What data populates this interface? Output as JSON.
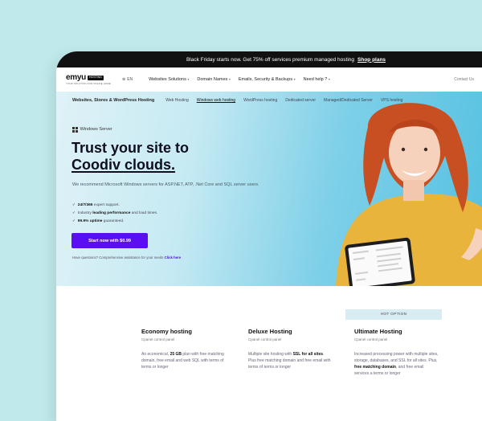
{
  "promo": {
    "text": "Black Friday starts now. Get 75% off services premium managed hosting",
    "link": "Shop plans"
  },
  "nav": {
    "logo_word": "emyu",
    "logo_badge": "HOSTING",
    "logo_tag": "YOUR SOLUTION FOR ONLINE HOME",
    "lang": "EN",
    "items": [
      "Websites Solutions",
      "Domain Names",
      "Emails, Security & Backups",
      "Need help ?"
    ],
    "contact": "Contact Us",
    "button": "S"
  },
  "subnav": {
    "category": "Websites, Stores & WordPress Hosting",
    "items": [
      "Web Hosting",
      "Windows web hosting",
      "WordPress hosting",
      "Dedicated server",
      "Managed/Dedicated Server",
      "VPS hosting"
    ],
    "active_index": 1
  },
  "hero": {
    "badge": "Windows Server",
    "title_line1": "Trust your site to",
    "title_line2": "Coodiv clouds.",
    "lead": "We recommend Microsoft Windows servers for ASP.NET, ATP, .Net Core and SQL server users.",
    "bullets": [
      {
        "bold": "24/7/365",
        "text": " expert support."
      },
      {
        "pre": "Industry ",
        "bold": "leading performance",
        "text": " and load times."
      },
      {
        "bold": "99.9% uptime",
        "text": " guaranteed."
      }
    ],
    "cta": "Start now with $0.99",
    "fineprint": "Have questions? Comprehensive assistance for your needs",
    "fineprint_link": "Click here"
  },
  "plans": {
    "hot_label": "HOT OPTION",
    "items": [
      {
        "name": "Economy hosting",
        "caption": "Cpanel control panel",
        "desc_pre": "An economical, ",
        "desc_bold": "25 GB",
        "desc_post": " plan with free matching domain, free email and web SQL with terms of terms or longer"
      },
      {
        "name": "Deluxe Hosting",
        "caption": "Cpanel control panel",
        "desc_pre": "Multiple site hosting with ",
        "desc_bold": "SSL for all sites",
        "desc_post": ". Plus free matching domain and free email with terms of terms or longer"
      },
      {
        "name": "Ultimate Hosting",
        "caption": "Cpanel control panel",
        "desc_pre": "Increased processing power with multiple sites, storage, databases, and SSL for all sites. Plus, ",
        "desc_bold": "free matching domain",
        "desc_post": ", and free email services a terms or longer"
      }
    ]
  },
  "colors": {
    "accent": "#5c0ef2",
    "dark": "#111111",
    "hero_start": "#dff2f7",
    "hero_end": "#4fbfe0"
  }
}
